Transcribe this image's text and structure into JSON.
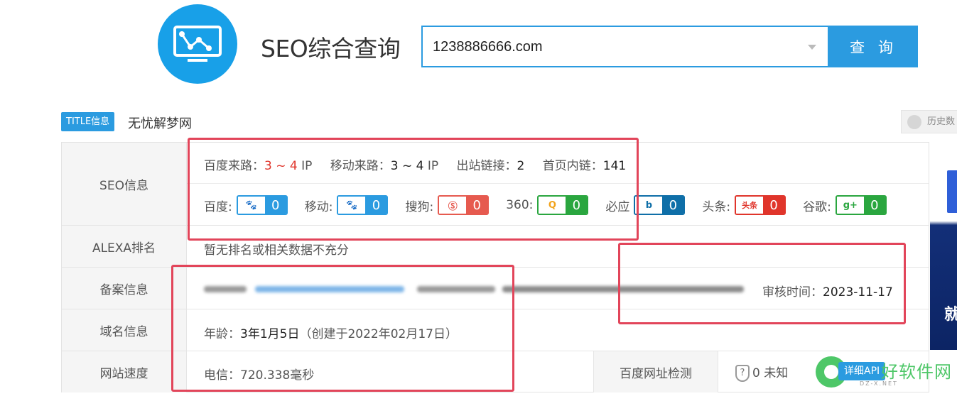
{
  "header": {
    "title": "SEO综合查询",
    "search_value": "1238886666.com",
    "search_button": "查 询"
  },
  "title_row": {
    "tag": "TITLE信息",
    "site_title": "无忧解梦网",
    "history_button": "历史数"
  },
  "seo": {
    "label": "SEO信息",
    "baidu_traffic_label": "百度来路：",
    "baidu_traffic_value": "3 ~ 4",
    "baidu_traffic_unit": " IP",
    "mobile_traffic_label": "移动来路：",
    "mobile_traffic_value": "3 ~ 4",
    "mobile_traffic_unit": " IP",
    "outlinks_label": "出站链接：",
    "outlinks_value": "2",
    "homepage_links_label": "首页内链：",
    "homepage_links_value": "141",
    "weights": [
      {
        "label": "百度:",
        "value": "0",
        "color": "#2b9be0",
        "icon": "paw-icon"
      },
      {
        "label": "移动:",
        "value": "0",
        "color": "#2b9be0",
        "icon": "mobile-paw-icon"
      },
      {
        "label": "搜狗:",
        "value": "0",
        "color": "#e65a4f",
        "icon": "sogou-icon"
      },
      {
        "label": "360:",
        "value": "0",
        "color": "#2aa63f",
        "icon": "360-icon"
      },
      {
        "label": "必应",
        "value": "0",
        "color": "#0f6fa8",
        "icon": "bing-icon"
      },
      {
        "label": "头条:",
        "value": "0",
        "color": "#e0352b",
        "icon": "toutiao-icon"
      },
      {
        "label": "谷歌:",
        "value": "0",
        "color": "#2aa63f",
        "icon": "google-plus-icon"
      }
    ]
  },
  "alexa": {
    "label": "ALEXA排名",
    "value": "暂无排名或相关数据不充分"
  },
  "beian": {
    "label": "备案信息",
    "review_label": "审核时间：",
    "review_value": "2023-11-17"
  },
  "domain": {
    "label": "域名信息",
    "age_label": "年龄：",
    "age_value": "3年1月5日",
    "created": "（创建于2022年02月17日）"
  },
  "speed": {
    "label": "网站速度",
    "telecom_label": "电信：",
    "telecom_value": "720.338毫秒",
    "check_label": "百度网址检测",
    "check_value": "0 未知"
  },
  "ad": {
    "text": "就"
  },
  "watermark": {
    "detail_button": "详细API",
    "brand": "好软件网",
    "url": "DZ-X.NET"
  }
}
